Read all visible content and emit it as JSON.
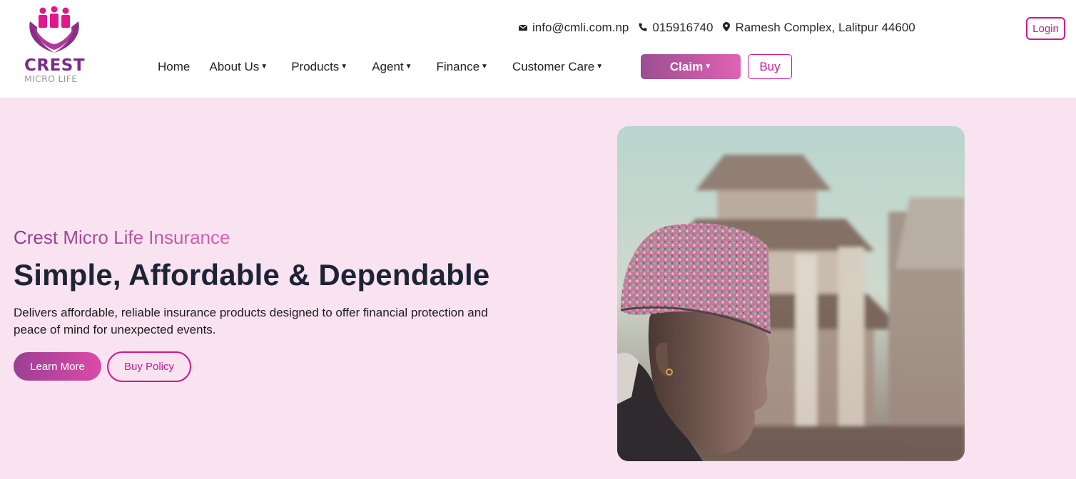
{
  "brand": {
    "name_line1": "CREST",
    "name_line2": "MICRO LIFE",
    "colors": {
      "primary": "#d4168b",
      "purple": "#7a2a8a",
      "hero_bg": "#f9e3f1",
      "heading": "#1d2435"
    }
  },
  "contact": {
    "email": "info@cmli.com.np",
    "phone": "015916740",
    "address": "Ramesh Complex, Lalitpur 44600",
    "icons": [
      "envelope-icon",
      "phone-icon",
      "location-pin-icon"
    ]
  },
  "login_label": "Login",
  "nav": {
    "items": [
      {
        "label": "Home",
        "dropdown": false
      },
      {
        "label": "About Us",
        "dropdown": true
      },
      {
        "label": "Products",
        "dropdown": true
      },
      {
        "label": "Agent",
        "dropdown": true
      },
      {
        "label": "Finance",
        "dropdown": true
      },
      {
        "label": "Customer Care",
        "dropdown": true
      }
    ],
    "claim_label": "Claim",
    "buy_label": "Buy"
  },
  "hero": {
    "subtitle": "Crest Micro Life Insurance",
    "headline": "Simple, Affordable & Dependable",
    "description": "Delivers affordable, reliable insurance products designed to offer financial protection and peace of mind for unexpected events.",
    "learn_more_label": "Learn More",
    "buy_policy_label": "Buy Policy"
  }
}
